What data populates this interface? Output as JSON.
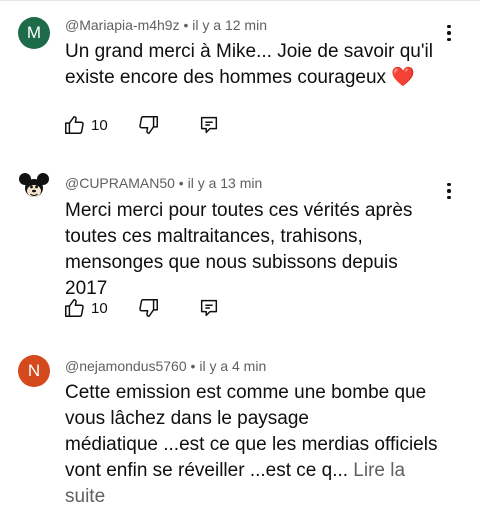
{
  "comments": [
    {
      "avatar_letter": "M",
      "avatar_color": "#1e6b4a",
      "handle": "@Mariapia-m4h9z",
      "separator": " • ",
      "time": "il y a 12 min",
      "lines": [
        "Un grand merci à Mike... Joie de savoir qu'il",
        "existe encore des hommes courageux"
      ],
      "emoji": "❤️",
      "likes": "10"
    },
    {
      "avatar_icon": "mickey-icon",
      "handle": "@CUPRAMAN50",
      "separator": " • ",
      "time": "il y a 13 min",
      "lines": [
        "Merci merci pour toutes ces vérités après",
        "toutes ces maltraitances, trahisons,",
        "mensonges que nous subissons depuis 2017"
      ],
      "likes": "10"
    },
    {
      "avatar_letter": "N",
      "avatar_color": "#d44a1c",
      "handle": "@nejamondus5760",
      "separator": " • ",
      "time": "il y a 4 min",
      "lines": [
        "Cette emission est comme une bombe que",
        "vous lâchez dans le paysage",
        "médiatique ...est ce que les merdias officiels",
        "vont enfin se réveiller ...est ce q..."
      ],
      "read_more": " Lire la suite"
    }
  ],
  "colors": {
    "heart": "#e0242c",
    "meta": "#606060",
    "text": "#0f0f0f"
  }
}
